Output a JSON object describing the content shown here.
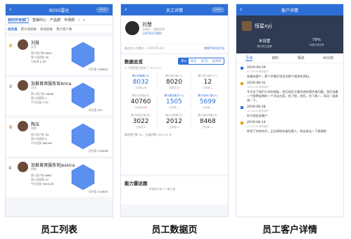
{
  "phone1": {
    "title": "BOSS雷达",
    "tabs": [
      "我的所有部门",
      "营销中心",
      "产品部",
      "市场部"
    ],
    "subtabs": [
      "综合值",
      "累计线索数",
      "新线索数",
      "累计客户数"
    ],
    "cards": [
      {
        "rank_icon": "crown-gold-icon",
        "name": "刘慧",
        "role": "店长",
        "lines": [
          [
            "累计客户数",
            "8031"
          ],
          [
            "累计线索数",
            "35"
          ],
          [
            "日新增",
            "1,35"
          ]
        ],
        "score_label": "综合值",
        "score": "128342"
      },
      {
        "rank_icon": "crown-silver-icon",
        "name": "加推首席服务官Anna",
        "role": "店长",
        "lines": [
          [
            "累计客户数",
            "10050"
          ],
          [
            "累计线索数",
            "1"
          ],
          [
            "平均回复",
            "7.37"
          ]
        ],
        "score_label": "综合值",
        "score": "127"
      },
      {
        "rank_icon": "crown-bronze-icon",
        "name": "陶洁",
        "role": "销售",
        "lines": [
          [
            "累计客户数",
            "34"
          ],
          [
            "累计线索数",
            "5"
          ],
          [
            "平均回复",
            "905.83"
          ]
        ],
        "score_label": "综合值",
        "score": "115258"
      },
      {
        "rank_icon": "rank-4",
        "name": "加推首席服务官Jessica",
        "role": "销售",
        "lines": [
          [
            "累计客户数",
            "6997"
          ],
          [
            "累计线索数",
            "27"
          ],
          [
            "平均回复",
            "3024.49"
          ]
        ],
        "score_label": "综合值",
        "score": "111625"
      }
    ]
  },
  "phone2": {
    "title": "员工详情",
    "name": "刘慧",
    "dept": "总经办 · 高级经理",
    "phone": "13670227860",
    "join_label": "最近加入AI雷达：",
    "join_date": "2019-05-14",
    "join_link": "查看TA的名片码",
    "overview_title": "数据总览",
    "update_text": "以下数据最近更新于 16:41:31",
    "periods": [
      "累计",
      "昨日",
      "近7天",
      "近30天"
    ],
    "active_period": 0,
    "metrics": [
      {
        "label": "累计线索数(人)",
        "value": "8032",
        "sub_label": "日新增",
        "sub_value": "24",
        "blue": true
      },
      {
        "label": "累计客户数(人)",
        "value": "8020",
        "sub_label": "日新增",
        "sub_value": "21",
        "blue": false
      },
      {
        "label": "累计成交客户(人)",
        "value": "12",
        "sub_label": "日新增",
        "sub_value": "—",
        "blue": false
      },
      {
        "label": "累计访问量(次)",
        "value": "40760",
        "sub_label": "日新增",
        "sub_value": "433",
        "blue": false
      },
      {
        "label": "累计跟进客户(人)",
        "value": "1505",
        "sub_label": "日新增",
        "sub_value": "—",
        "blue": true
      },
      {
        "label": "累计咨询人数(人)",
        "value": "5699",
        "sub_label": "日新增",
        "sub_value": "—",
        "blue": true
      },
      {
        "label": "累计转发次数(次)",
        "value": "3022",
        "sub_label": "日新增",
        "sub_value": "2",
        "blue": false
      },
      {
        "label": "累计点赞数(次)",
        "value": "2012",
        "sub_label": "日新增",
        "sub_value": "2",
        "blue": false
      },
      {
        "label": "累计保存次数(次)",
        "value": "8468",
        "sub_label": "日新增",
        "sub_value": "—",
        "blue": false
      }
    ],
    "summary": "跟进客户数 18 ，沟通次数 1903.42 元",
    "radar_title": "能力雷达图",
    "radar_labels": "获客能力值  个人魅力值"
  },
  "phone3": {
    "title": "客户详情",
    "name": "恒星xyj",
    "stats": [
      {
        "value": "未设置",
        "label": "预计成交金额"
      },
      {
        "value": "79%",
        "label": "AI预计成交率"
      }
    ],
    "tabs": [
      "互动",
      "资料",
      "相关",
      "AI分析"
    ],
    "active_tab": 0,
    "entries": [
      {
        "date": "2019-09-29",
        "time": "07:55:09 联系客户",
        "text": "准备给客户，那个早晚们项目的那个相关的资料。",
        "dot": "blue"
      },
      {
        "date": "2019-08-31",
        "time": "16:51:35 联系客户",
        "text": "今天见了他们公司的老板，然后现在主要考虑的是价格问题，然后准备一个那种促销的一个活动方案，给了他，然后，约下周一，再见一面参观一下。",
        "dot": "gold"
      },
      {
        "date": "2019-06-28",
        "time": "14:14:32 联系客户",
        "text": "你已锁定该客户",
        "dot": "blue"
      },
      {
        "date": "2019-06-14",
        "time": "11:35:34 联系客户",
        "text": "转发了你的名片，正在帮助你留住客人，快去表达一下感谢吧",
        "dot": "gold"
      }
    ]
  },
  "captions": [
    "员工列表",
    "员工数据页",
    "员工客户详情"
  ]
}
